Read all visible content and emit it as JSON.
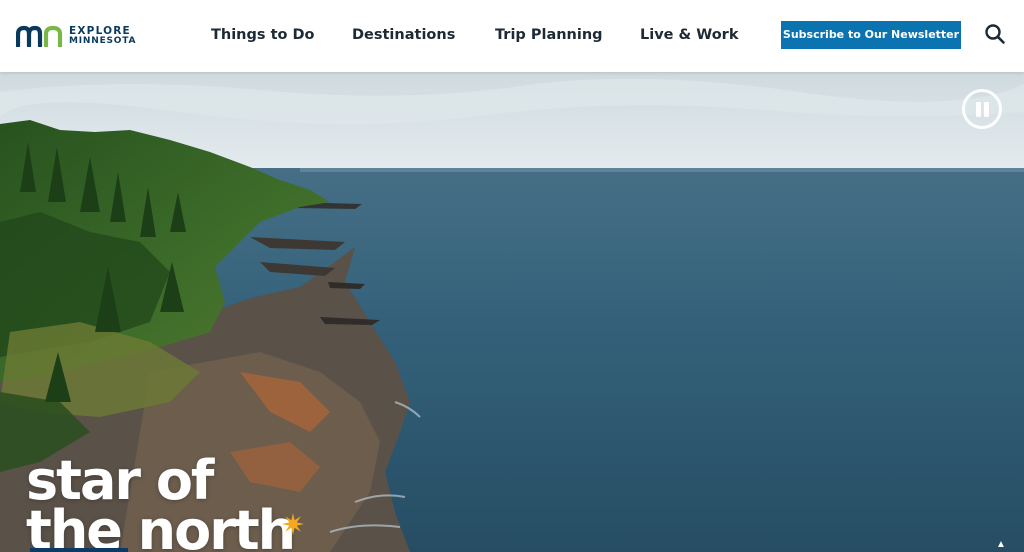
{
  "header": {
    "logo": {
      "line1": "EXPLORE",
      "line2": "MINNESOTA",
      "mark_color_primary": "#0a3a5b",
      "mark_color_accent": "#7ab648"
    },
    "nav": [
      {
        "label": "Things to Do"
      },
      {
        "label": "Destinations"
      },
      {
        "label": "Trip Planning"
      },
      {
        "label": "Live & Work"
      }
    ],
    "subscribe_label": "Subscribe to Our Newsletter",
    "subscribe_color": "#0b73b0",
    "search_icon": "search-icon"
  },
  "hero": {
    "headline_line1": "star of",
    "headline_line2": "the north",
    "accent_icon": "star-icon",
    "accent_color": "#f4a91e",
    "pause_icon": "pause-icon",
    "video_state": "playing"
  }
}
